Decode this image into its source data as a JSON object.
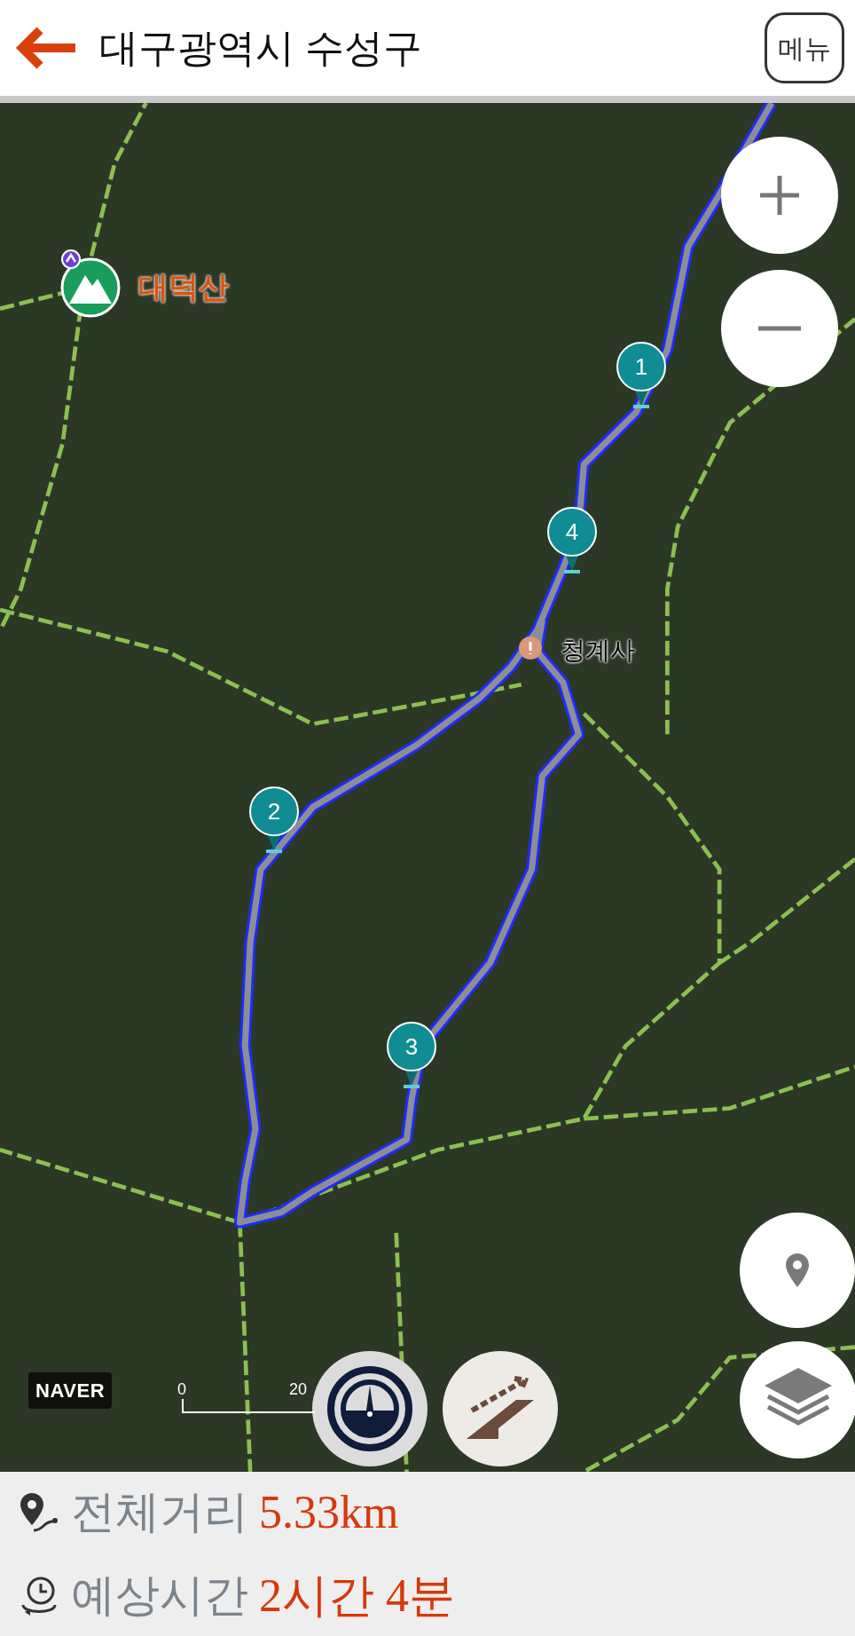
{
  "header": {
    "title": "대구광역시 수성구",
    "menu_button": "메뉴"
  },
  "map": {
    "places": [
      {
        "name": "대덕산",
        "kind": "mountain"
      },
      {
        "name": "청계사",
        "kind": "temple"
      }
    ],
    "waypoints": [
      "1",
      "4",
      "2",
      "3"
    ],
    "attribution": "NAVER",
    "scale_labels": [
      "0",
      "20"
    ]
  },
  "summary": [
    {
      "label": "전체거리",
      "value": "5.33km",
      "kind": "distance"
    },
    {
      "label": "예상시간",
      "value": "2시간 4분",
      "kind": "time"
    }
  ]
}
